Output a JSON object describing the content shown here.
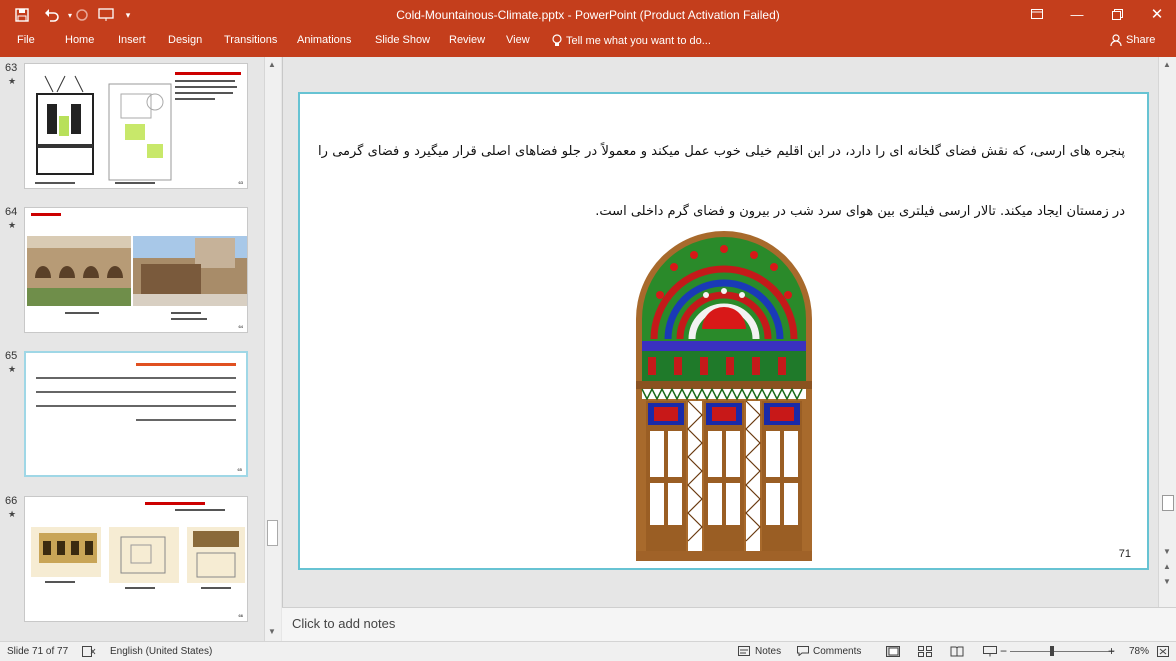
{
  "app": {
    "title": "Cold-Mountainous-Climate.pptx - PowerPoint (Product Activation Failed)",
    "accent": "#c43e1c"
  },
  "quick_access": {
    "save_icon": "save-icon",
    "undo_icon": "undo-icon",
    "redo_icon": "redo-icon",
    "present_icon": "present-icon"
  },
  "ribbon": {
    "tabs": [
      "File",
      "Home",
      "Insert",
      "Design",
      "Transitions",
      "Animations",
      "Slide Show",
      "Review",
      "View"
    ],
    "tell_me": "Tell me what you want to do...",
    "share": "Share"
  },
  "thumbnails": [
    {
      "number": "63",
      "star": "★",
      "page": "63",
      "heading": "",
      "caption": ""
    },
    {
      "number": "64",
      "star": "★",
      "page": "64",
      "heading": "",
      "caption": ""
    },
    {
      "number": "65",
      "star": "★",
      "page": "65",
      "heading": "",
      "caption": ""
    },
    {
      "number": "66",
      "star": "★",
      "page": "66",
      "heading": "",
      "caption": ""
    }
  ],
  "slide": {
    "text": "پنجره های ارسی، که نقش فضای گلخانه ای را دارد، در این اقلیم خیلی خوب عمل میکند و معمولاً در جلو فضاهای اصلی قرار میگیرد و فضای گرمی را در زمستان ایجاد میکند. تالار ارسی فیلتری بین هوای سرد شب در بیرون و فضای گرم داخلی است.",
    "page_number": "71"
  },
  "notes": {
    "placeholder": "Click to add notes"
  },
  "status": {
    "slide_info": "Slide 71 of 77",
    "language": "English (United States)",
    "notes": "Notes",
    "comments": "Comments",
    "zoom": "78%"
  }
}
